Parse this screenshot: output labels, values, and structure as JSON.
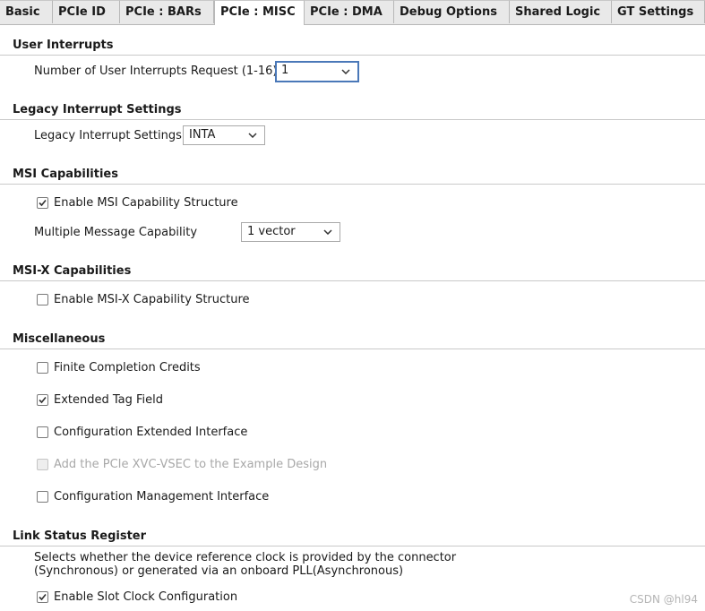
{
  "tabs": [
    {
      "label": "Basic"
    },
    {
      "label": "PCIe ID"
    },
    {
      "label": "PCIe : BARs"
    },
    {
      "label": "PCIe : MISC"
    },
    {
      "label": "PCIe : DMA"
    },
    {
      "label": "Debug Options"
    },
    {
      "label": "Shared Logic"
    },
    {
      "label": "GT Settings"
    }
  ],
  "active_tab": "PCIe : MISC",
  "user_interrupts": {
    "title": "User Interrupts",
    "request_label": "Number of User Interrupts Request (1-16)",
    "request_value": "1"
  },
  "legacy": {
    "title": "Legacy Interrupt Settings",
    "settings_label": "Legacy Interrupt Settings",
    "settings_value": "INTA"
  },
  "msi": {
    "title": "MSI Capabilities",
    "enable_label": "Enable MSI Capability Structure",
    "enable_checked": true,
    "multiple_label": "Multiple Message Capability",
    "multiple_value": "1 vector"
  },
  "msix": {
    "title": "MSI-X Capabilities",
    "enable_label": "Enable MSI-X Capability Structure",
    "enable_checked": false
  },
  "misc": {
    "title": "Miscellaneous",
    "items": [
      {
        "label": "Finite Completion Credits",
        "checked": false,
        "disabled": false
      },
      {
        "label": "Extended Tag Field",
        "checked": true,
        "disabled": false
      },
      {
        "label": "Configuration Extended Interface",
        "checked": false,
        "disabled": false
      },
      {
        "label": "Add the PCIe XVC-VSEC to the Example Design",
        "checked": false,
        "disabled": true
      },
      {
        "label": "Configuration Management Interface",
        "checked": false,
        "disabled": false
      }
    ]
  },
  "link_status": {
    "title": "Link Status Register",
    "description_line1": "Selects whether the device reference clock is provided by the connector",
    "description_line2": "(Synchronous) or generated via an onboard PLL(Asynchronous)",
    "slot_clock_label": "Enable Slot Clock Configuration",
    "slot_clock_checked": true
  },
  "watermark": "CSDN @hl94",
  "colors": {
    "focus_border": "#4a78b8",
    "tab_bg": "#e9e9e9",
    "rule": "#c9c9c9",
    "disabled_text": "#a8a8a8"
  }
}
